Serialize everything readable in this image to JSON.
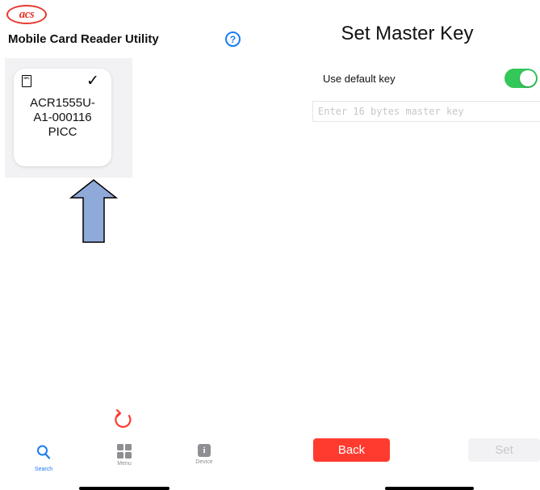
{
  "left": {
    "logo_text": "acs",
    "app_title": "Mobile Card Reader Utility",
    "help_glyph": "?",
    "device_card": {
      "nfc_label": "NFC",
      "name_line1": "ACR1555U-",
      "name_line2": "A1-000116",
      "name_line3": "PICC",
      "selected": true
    },
    "tabs": [
      {
        "label": "Search",
        "icon": "search-icon",
        "active": true
      },
      {
        "label": "Menu",
        "icon": "grid-icon",
        "active": false
      },
      {
        "label": "Device",
        "icon": "info-icon",
        "glyph": "i",
        "active": false
      }
    ]
  },
  "right": {
    "title": "Set Master Key",
    "use_default_key_label": "Use default key",
    "use_default_key_on": true,
    "master_key_placeholder": "Enter 16 bytes master key",
    "master_key_value": "",
    "back_label": "Back",
    "set_label": "Set"
  },
  "colors": {
    "accent_blue": "#1a7cf5",
    "brand_red": "#e8392f",
    "back_red": "#ff3b30",
    "toggle_green": "#34c759",
    "arrow_fill": "#8fa9d9"
  }
}
